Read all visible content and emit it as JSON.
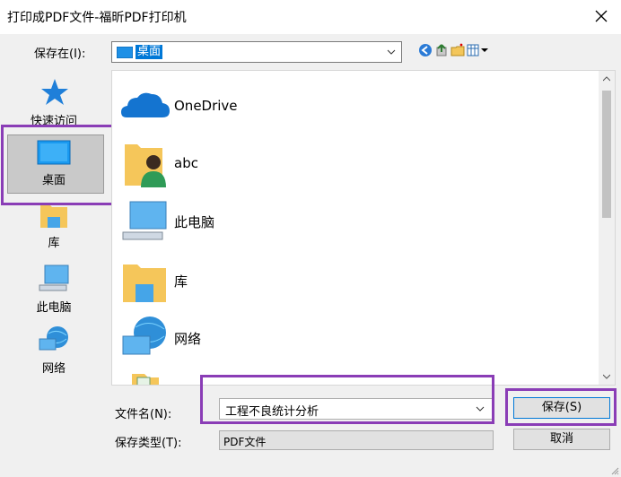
{
  "window": {
    "title": "打印成PDF文件-福昕PDF打印机"
  },
  "save_in": {
    "label": "保存在(I):",
    "value": "桌面"
  },
  "places": [
    {
      "label": "快速访问",
      "icon": "star-icon"
    },
    {
      "label": "桌面",
      "icon": "desktop-icon",
      "selected": true
    },
    {
      "label": "库",
      "icon": "library-icon"
    },
    {
      "label": "此电脑",
      "icon": "computer-icon"
    },
    {
      "label": "网络",
      "icon": "network-icon"
    }
  ],
  "files": [
    {
      "name": "OneDrive",
      "icon": "onedrive-cloud-icon"
    },
    {
      "name": "abc",
      "icon": "user-folder-icon"
    },
    {
      "name": "此电脑",
      "icon": "computer-icon"
    },
    {
      "name": "库",
      "icon": "library-icon"
    },
    {
      "name": "网络",
      "icon": "network-icon"
    }
  ],
  "filename": {
    "label": "文件名(N):",
    "value": "工程不良统计分析"
  },
  "filetype": {
    "label": "保存类型(T):",
    "value": "PDF文件"
  },
  "buttons": {
    "save": "保存(S)",
    "cancel": "取消"
  },
  "colors": {
    "selection": "#0078d7",
    "highlight_box": "#8a3db6"
  }
}
